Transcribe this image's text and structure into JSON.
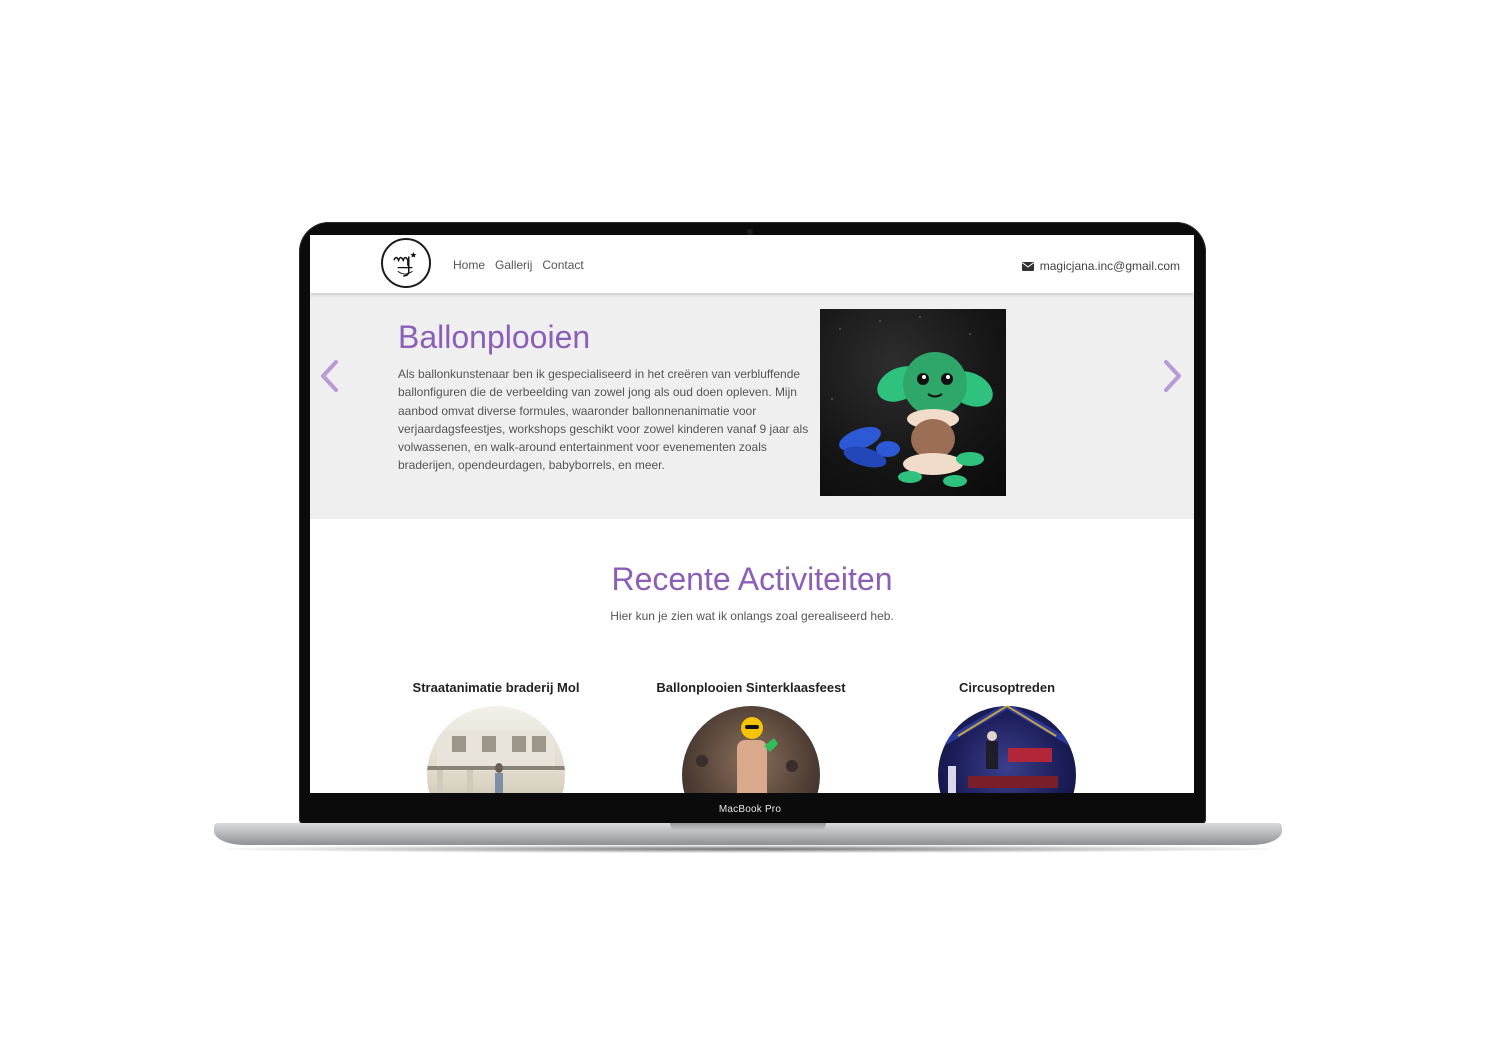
{
  "device": {
    "label": "MacBook Pro"
  },
  "header": {
    "logo_alt": "mj",
    "nav": [
      {
        "label": "Home"
      },
      {
        "label": "Gallerij"
      },
      {
        "label": "Contact"
      }
    ],
    "email": "magicjana.inc@gmail.com"
  },
  "hero": {
    "title": "Ballonplooien",
    "text": "Als ballonkunstenaar ben ik gespecialiseerd in het creëren van verbluffende ballonfiguren die de verbeelding van zowel jong als oud doen opleven. Mijn aanbod omvat diverse formules, waaronder ballonnenanimatie voor verjaardagsfeestjes, workshops geschikt voor zowel kinderen vanaf 9 jaar als volwassenen, en walk-around entertainment voor evenementen zoals braderijen, opendeurdagen, babyborrels, en meer."
  },
  "recent": {
    "title": "Recente Activiteiten",
    "subtitle": "Hier kun je zien wat ik onlangs zoal gerealiseerd heb.",
    "items": [
      {
        "title": "Straatanimatie braderij Mol"
      },
      {
        "title": "Ballonplooien Sinterklaasfeest"
      },
      {
        "title": "Circusoptreden"
      }
    ]
  },
  "colors": {
    "accent": "#8b5eb8",
    "arrow": "#b79ad6",
    "hero_bg": "#efefef"
  },
  "icons": {
    "prev": "chevron-left-icon",
    "next": "chevron-right-icon",
    "mail": "envelope-icon"
  }
}
